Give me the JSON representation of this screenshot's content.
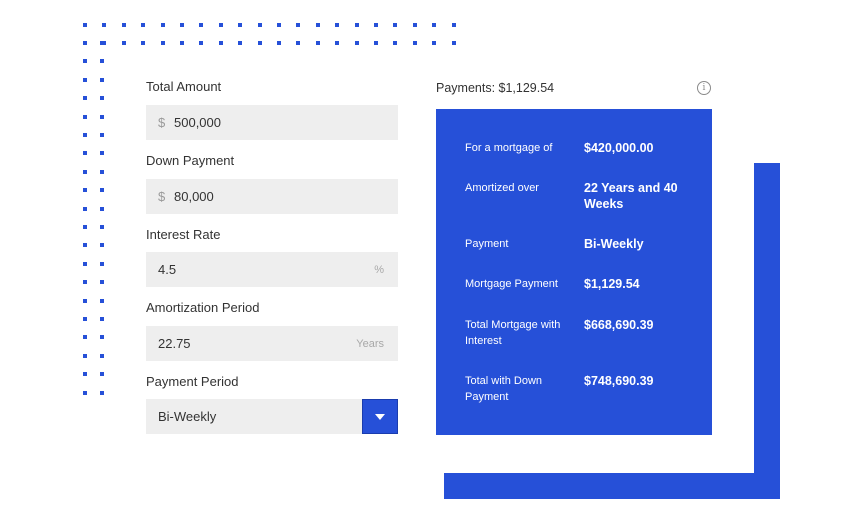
{
  "form": {
    "total_amount": {
      "label": "Total Amount",
      "prefix": "$",
      "value": "500,000"
    },
    "down_payment": {
      "label": "Down Payment",
      "prefix": "$",
      "value": "80,000"
    },
    "interest_rate": {
      "label": "Interest Rate",
      "value": "4.5",
      "suffix": "%"
    },
    "amortization_period": {
      "label": "Amortization Period",
      "value": "22.75",
      "suffix": "Years"
    },
    "payment_period": {
      "label": "Payment Period",
      "selected": "Bi-Weekly"
    }
  },
  "payments": {
    "header": "Payments: $1,129.54",
    "info_icon": "info-icon"
  },
  "summary": {
    "rows": [
      {
        "label": "For a mortgage of",
        "value": "$420,000.00"
      },
      {
        "label": "Amortized over",
        "value": "22 Years and 40 Weeks"
      },
      {
        "label": "Payment",
        "value": "Bi-Weekly"
      },
      {
        "label": "Mortgage Payment",
        "value": "$1,129.54"
      },
      {
        "label": "Total Mortgage with Interest",
        "value": "$668,690.39"
      },
      {
        "label": "Total with Down Payment",
        "value": "$748,690.39"
      }
    ]
  },
  "colors": {
    "accent": "#2650d8",
    "field_bg": "#eeeeee",
    "text": "#333333"
  }
}
